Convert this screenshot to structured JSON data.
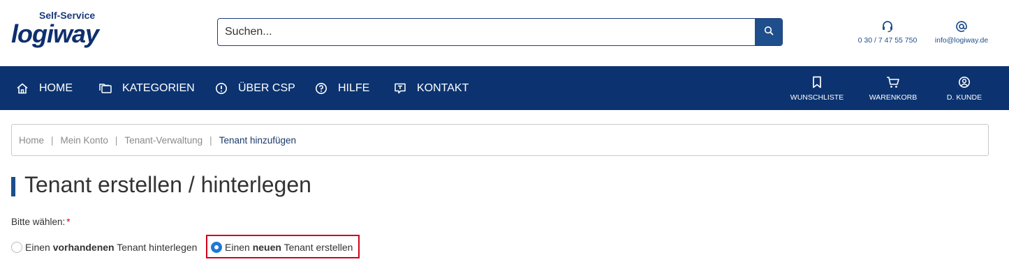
{
  "header": {
    "logo_subtitle": "Self-Service",
    "logo_word": "logiway",
    "search_placeholder": "Suchen...",
    "phone": "0 30 / 7 47 55 750",
    "email": "info@logiway.de"
  },
  "nav": {
    "items": [
      {
        "label": "HOME",
        "icon": "home-icon"
      },
      {
        "label": "KATEGORIEN",
        "icon": "folders-icon"
      },
      {
        "label": "ÜBER CSP",
        "icon": "info-circle-icon"
      },
      {
        "label": "HILFE",
        "icon": "help-circle-icon"
      },
      {
        "label": "KONTAKT",
        "icon": "message-icon"
      }
    ],
    "right": [
      {
        "label": "WUNSCHLISTE",
        "icon": "bookmark-icon"
      },
      {
        "label": "WARENKORB",
        "icon": "cart-icon"
      },
      {
        "label": "D. KUNDE",
        "icon": "user-icon"
      }
    ]
  },
  "breadcrumb": [
    "Home",
    "Mein Konto",
    "Tenant-Verwaltung",
    "Tenant hinzufügen"
  ],
  "page_title": "Tenant erstellen / hinterlegen",
  "form": {
    "label": "Bitte wählen:",
    "required_mark": "*",
    "options": [
      {
        "pre": "Einen ",
        "bold": "vorhandenen",
        "post": " Tenant hinterlegen",
        "checked": false
      },
      {
        "pre": "Einen ",
        "bold": "neuen",
        "post": " Tenant erstellen",
        "checked": true
      }
    ]
  },
  "colors": {
    "nav_bg": "#0c3370",
    "accent": "#1f4e8c",
    "radio_checked": "#1f78d8",
    "highlight": "#d0021b"
  }
}
